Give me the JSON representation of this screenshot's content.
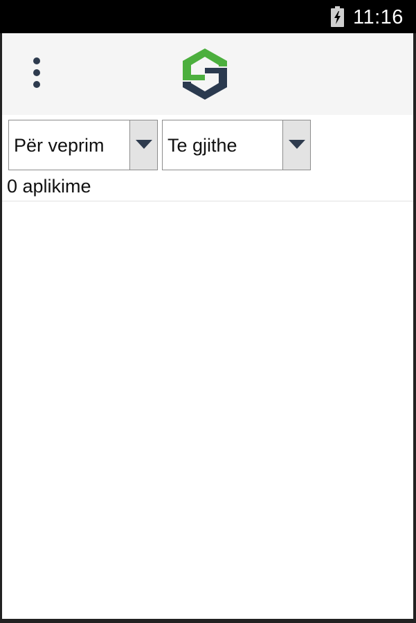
{
  "status_bar": {
    "time": "11:16",
    "battery_icon": "battery-charging-icon"
  },
  "app_bar": {
    "menu_icon": "overflow-menu-icon",
    "logo_icon": "s-hexagon-logo",
    "logo_colors": {
      "green": "#4caf3e",
      "navy": "#2b3a4f"
    }
  },
  "filters": {
    "status_filter": {
      "selected": "Për veprim"
    },
    "scope_filter": {
      "selected": "Te gjithe"
    }
  },
  "results": {
    "count_text": "0 aplikime",
    "items": []
  },
  "colors": {
    "status_bar_bg": "#000000",
    "app_bar_bg": "#f5f5f5",
    "arrow_color": "#2e3b4e"
  }
}
